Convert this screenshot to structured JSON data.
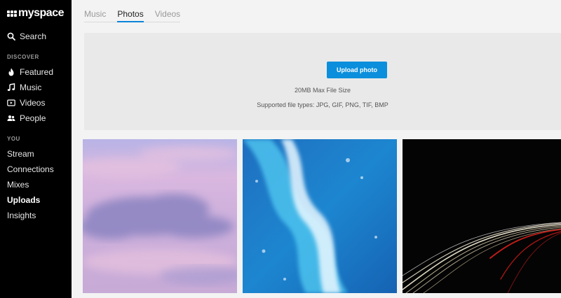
{
  "brand": {
    "name": "myspace"
  },
  "sidebar": {
    "search_label": "Search",
    "discover_heading": "DISCOVER",
    "discover_items": [
      {
        "label": "Featured",
        "icon": "flame-icon"
      },
      {
        "label": "Music",
        "icon": "music-note-icon"
      },
      {
        "label": "Videos",
        "icon": "video-play-icon"
      },
      {
        "label": "People",
        "icon": "people-icon"
      }
    ],
    "you_heading": "YOU",
    "you_items": [
      {
        "label": "Stream",
        "active": false
      },
      {
        "label": "Connections",
        "active": false
      },
      {
        "label": "Mixes",
        "active": false
      },
      {
        "label": "Uploads",
        "active": true
      },
      {
        "label": "Insights",
        "active": false
      }
    ]
  },
  "tabs": [
    {
      "label": "Music",
      "active": false
    },
    {
      "label": "Photos",
      "active": true
    },
    {
      "label": "Videos",
      "active": false
    }
  ],
  "upload": {
    "button_label": "Upload photo",
    "max_size": "20MB Max File Size",
    "file_types": "Supported file types: JPG, GIF, PNG, TIF, BMP"
  },
  "photos": [
    {
      "subject": "purple-pink cloudy sky"
    },
    {
      "subject": "ocean wake foam"
    },
    {
      "subject": "night highway light trails"
    }
  ],
  "colors": {
    "accent": "#0b8fdc",
    "sidebar_bg": "#000000",
    "page_bg": "#f3f3f3"
  }
}
